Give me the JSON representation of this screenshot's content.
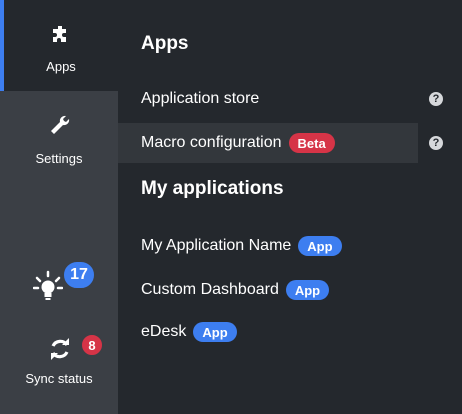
{
  "rail": {
    "apps": {
      "label": "Apps",
      "icon": "puzzle-icon"
    },
    "settings": {
      "label": "Settings",
      "icon": "wrench-icon"
    },
    "notifications": {
      "count": "17",
      "icon": "lightbulb-icon"
    },
    "sync": {
      "label": "Sync status",
      "count": "8",
      "icon": "sync-icon"
    }
  },
  "apps_section": {
    "title": "Apps",
    "items": [
      {
        "label": "Application store",
        "help_icon": "help-icon"
      },
      {
        "label": "Macro configuration",
        "badge": "Beta",
        "help_icon": "help-icon"
      }
    ]
  },
  "my_applications": {
    "title": "My applications",
    "items": [
      {
        "label": "My Application Name",
        "badge": "App"
      },
      {
        "label": "Custom Dashboard",
        "badge": "App"
      },
      {
        "label": "eDesk",
        "badge": "App"
      }
    ]
  },
  "colors": {
    "rail_bg": "#3b3f45",
    "panel_bg": "#24282d",
    "accent_blue": "#3d7ef0",
    "badge_red": "#d63447"
  }
}
